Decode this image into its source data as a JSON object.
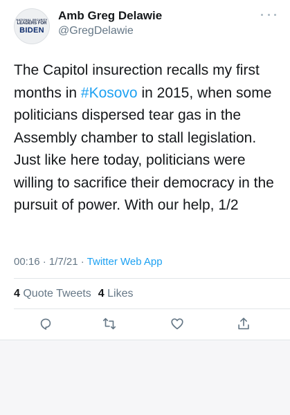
{
  "author": {
    "avatar_line1": "NATIONAL SECURITY",
    "avatar_line2": "LEADERS FOR",
    "avatar_line3": "BIDEN",
    "display_name": "Amb Greg Delawie",
    "handle": "@GregDelawie"
  },
  "tweet": {
    "text_before": "The Capitol insurection recalls my first months in ",
    "hashtag": "#Kosovo",
    "text_after": " in 2015, when some politicians dispersed tear gas in the Assembly chamber to stall legislation.  Just like here today, politicians were willing to sacrifice their democracy in the pursuit of power. With our help, 1/2",
    "time": "00:16",
    "date": "1/7/21",
    "source": "Twitter Web App"
  },
  "stats": {
    "quote_count": "4",
    "quote_label": "Quote Tweets",
    "like_count": "4",
    "like_label": "Likes"
  },
  "icons": {
    "more": "more-icon",
    "reply": "reply-icon",
    "retweet": "retweet-icon",
    "like": "heart-icon",
    "share": "share-icon"
  },
  "colors": {
    "link": "#1da1f2",
    "secondary_text": "#657786",
    "icon": "#657786"
  }
}
